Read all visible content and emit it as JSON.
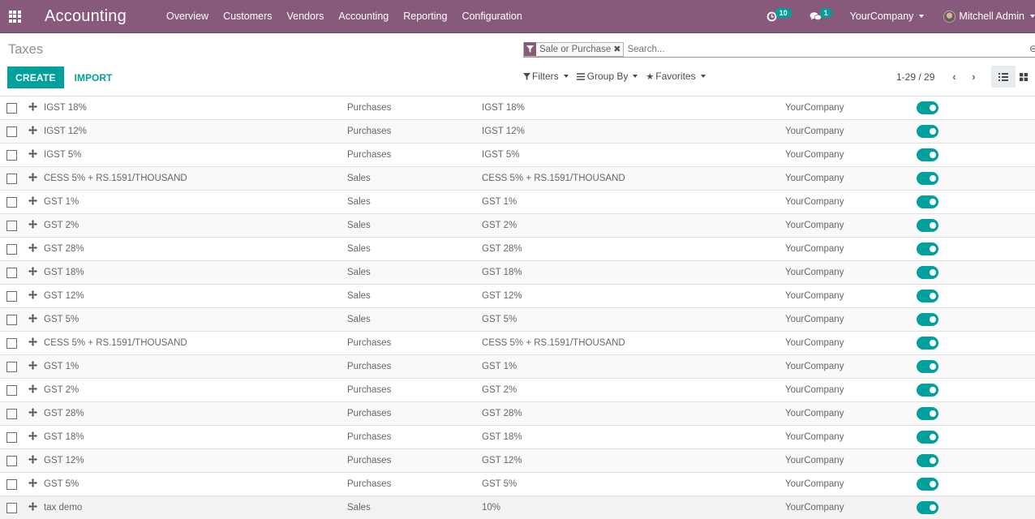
{
  "navbar": {
    "app_name": "Accounting",
    "menu": [
      "Overview",
      "Customers",
      "Vendors",
      "Accounting",
      "Reporting",
      "Configuration"
    ],
    "activity_count": "10",
    "message_count": "1",
    "company": "YourCompany",
    "user": "Mitchell Admin"
  },
  "control_panel": {
    "breadcrumb": "Taxes",
    "create_label": "CREATE",
    "import_label": "IMPORT",
    "search": {
      "facet_value": "Sale or Purchase",
      "placeholder": "Search..."
    },
    "filters_label": "Filters",
    "groupby_label": "Group By",
    "favorites_label": "Favorites",
    "pager": "1-29 / 29"
  },
  "rows": [
    {
      "name": "IGST 18%",
      "type": "Purchases",
      "label": "IGST 18%",
      "company": "YourCompany",
      "active": true
    },
    {
      "name": "IGST 12%",
      "type": "Purchases",
      "label": "IGST 12%",
      "company": "YourCompany",
      "active": true
    },
    {
      "name": "IGST 5%",
      "type": "Purchases",
      "label": "IGST 5%",
      "company": "YourCompany",
      "active": true
    },
    {
      "name": "CESS 5% + RS.1591/THOUSAND",
      "type": "Sales",
      "label": "CESS 5% + RS.1591/THOUSAND",
      "company": "YourCompany",
      "active": true
    },
    {
      "name": "GST 1%",
      "type": "Sales",
      "label": "GST 1%",
      "company": "YourCompany",
      "active": true
    },
    {
      "name": "GST 2%",
      "type": "Sales",
      "label": "GST 2%",
      "company": "YourCompany",
      "active": true
    },
    {
      "name": "GST 28%",
      "type": "Sales",
      "label": "GST 28%",
      "company": "YourCompany",
      "active": true
    },
    {
      "name": "GST 18%",
      "type": "Sales",
      "label": "GST 18%",
      "company": "YourCompany",
      "active": true
    },
    {
      "name": "GST 12%",
      "type": "Sales",
      "label": "GST 12%",
      "company": "YourCompany",
      "active": true
    },
    {
      "name": "GST 5%",
      "type": "Sales",
      "label": "GST 5%",
      "company": "YourCompany",
      "active": true
    },
    {
      "name": "CESS 5% + RS.1591/THOUSAND",
      "type": "Purchases",
      "label": "CESS 5% + RS.1591/THOUSAND",
      "company": "YourCompany",
      "active": true
    },
    {
      "name": "GST 1%",
      "type": "Purchases",
      "label": "GST 1%",
      "company": "YourCompany",
      "active": true
    },
    {
      "name": "GST 2%",
      "type": "Purchases",
      "label": "GST 2%",
      "company": "YourCompany",
      "active": true
    },
    {
      "name": "GST 28%",
      "type": "Purchases",
      "label": "GST 28%",
      "company": "YourCompany",
      "active": true
    },
    {
      "name": "GST 18%",
      "type": "Purchases",
      "label": "GST 18%",
      "company": "YourCompany",
      "active": true
    },
    {
      "name": "GST 12%",
      "type": "Purchases",
      "label": "GST 12%",
      "company": "YourCompany",
      "active": true
    },
    {
      "name": "GST 5%",
      "type": "Purchases",
      "label": "GST 5%",
      "company": "YourCompany",
      "active": true
    },
    {
      "name": "tax demo",
      "type": "Sales",
      "label": "10%",
      "company": "YourCompany",
      "active": true
    }
  ]
}
